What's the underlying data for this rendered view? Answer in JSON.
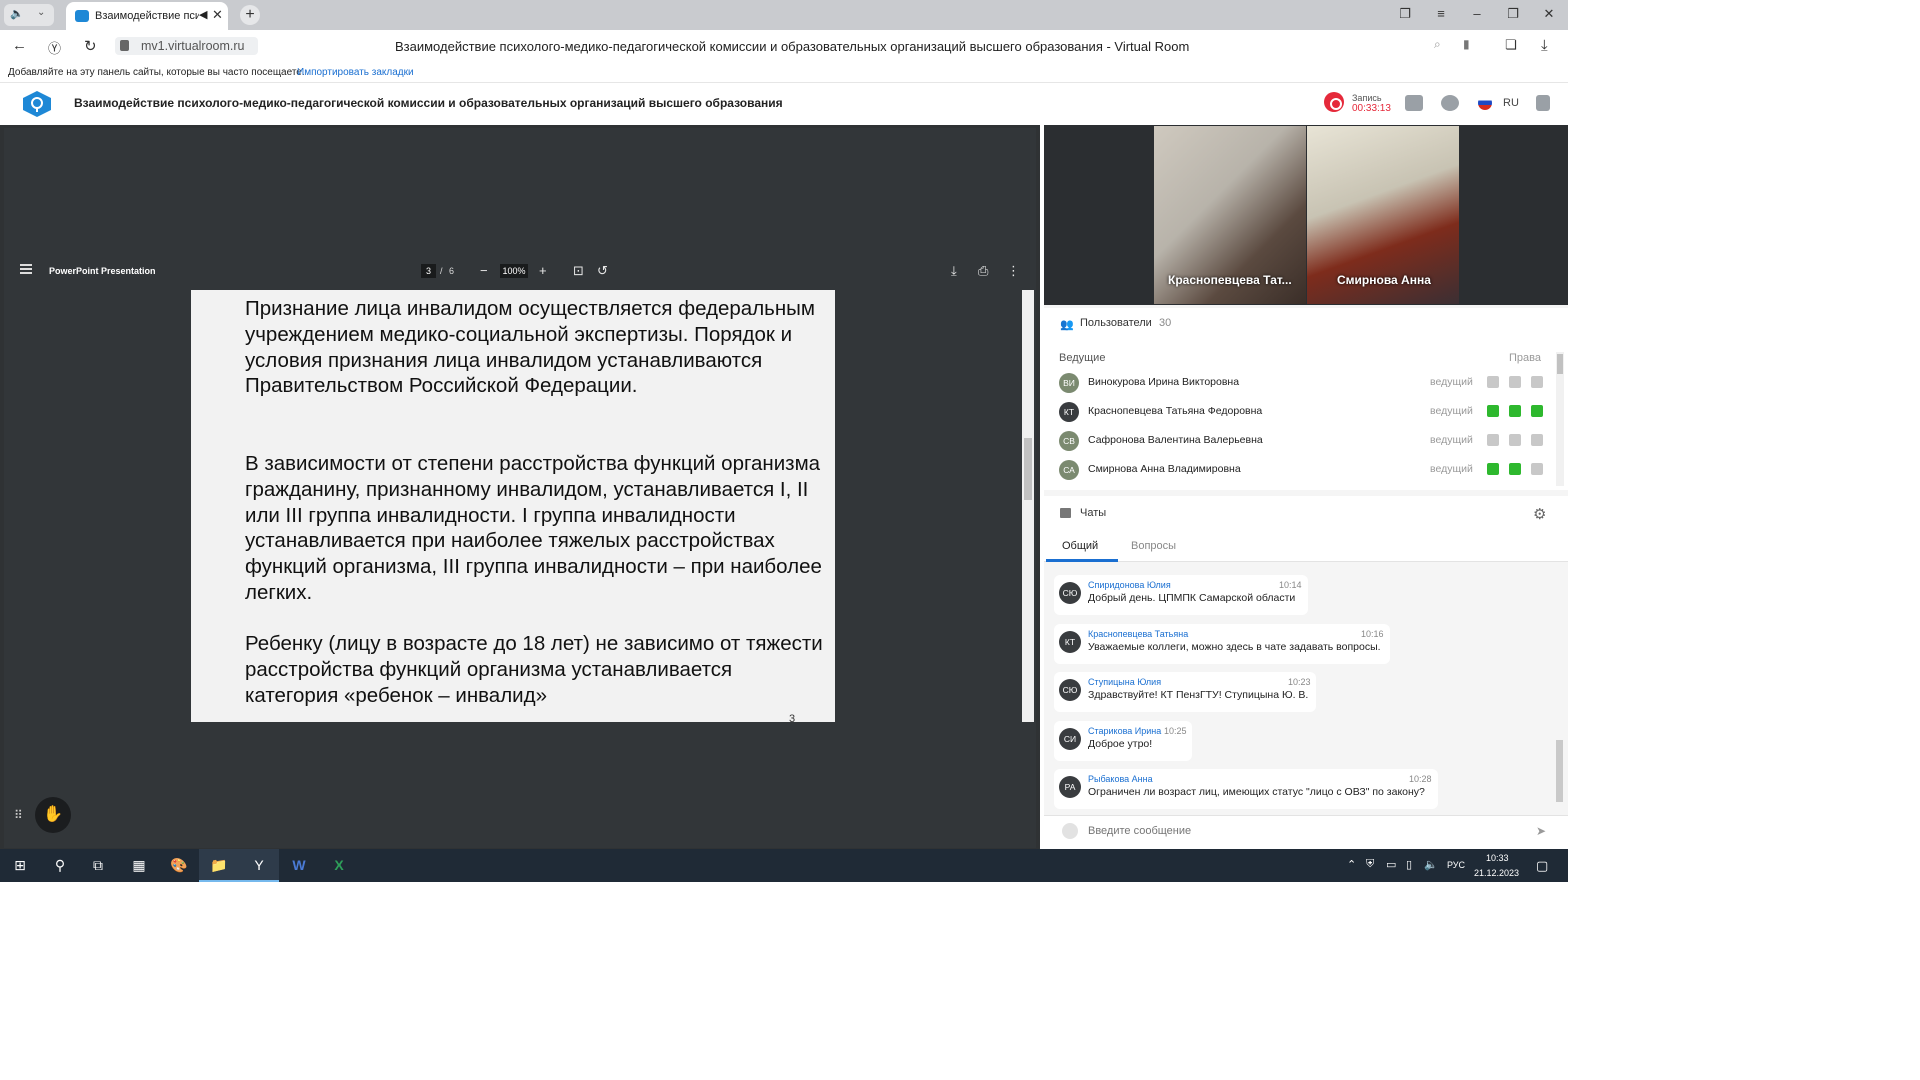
{
  "browser": {
    "tab_title": "Взаимодействие пси",
    "url": "mv1.virtualroom.ru",
    "page_title": "Взаимодействие психолого-медико-педагогической комиссии и образовательных организаций высшего образования - Virtual Room",
    "bookmarks_hint": "Добавляйте на эту панель сайты, которые вы часто посещаете.",
    "bookmarks_link": "Импортировать закладки"
  },
  "app": {
    "title": "Взаимодействие психолого-медико-педагогической комиссии и образовательных организаций высшего образования",
    "record_label": "Запись",
    "record_time": "00:33:13",
    "language": "RU"
  },
  "pdf": {
    "title": "PowerPoint Presentation",
    "current_page": "3",
    "separator": "/",
    "total_pages": "6",
    "zoom": "100%",
    "paragraphs": [
      "Признание лица инвалидом осуществляется федеральным учреждением медико-социальной экспертизы. Порядок и условия признания лица инвалидом устанавливаются Правительством Российской Федерации.",
      "В зависимости от степени расстройства функций организма гражданину, признанному инвалидом, устанавливается I, II или III группа инвалидности. I группа инвалидности устанавливается при наиболее тяжелых расстройствах функций организма, III группа инвалидности – при наиболее легких.",
      "Ребенку (лицу в возрасте до 18 лет) не зависимо от тяжести расстройства функций организма устанавливается категория «ребенок – инвалид»"
    ],
    "slide_number": "3"
  },
  "video": {
    "participants": [
      "Краснопевцева Тат...",
      "Смирнова Анна"
    ]
  },
  "users": {
    "label": "Пользователи",
    "count": "30",
    "section": "Ведущие",
    "rights_label": "Права",
    "items": [
      {
        "initials": "ВИ",
        "name": "Винокурова Ирина Викторовна",
        "role": "ведущий",
        "color": "#7b8a70"
      },
      {
        "initials": "КТ",
        "name": "Краснопевцева Татьяна Федоровна",
        "role": "ведущий",
        "color": "#393c3f"
      },
      {
        "initials": "СВ",
        "name": "Сафронова Валентина Валерьевна",
        "role": "ведущий",
        "color": "#7b8a70"
      },
      {
        "initials": "СА",
        "name": "Смирнова Анна Владимировна",
        "role": "ведущий",
        "color": "#7b8a70"
      }
    ]
  },
  "chats": {
    "label": "Чаты",
    "tabs": [
      "Общий",
      "Вопросы"
    ],
    "messages": [
      {
        "initials": "СЮ",
        "author": "Спиридонова Юлия",
        "time": "10:14",
        "text": "Добрый день. ЦПМПК Самарской области"
      },
      {
        "initials": "КТ",
        "author": "Краснопевцева Татьяна",
        "time": "10:16",
        "text": "Уважаемые коллеги, можно здесь в чате задавать вопросы."
      },
      {
        "initials": "СЮ",
        "author": "Ступицына Юлия",
        "time": "10:23",
        "text": "Здравствуйте! КТ ПензГТУ! Ступицына Ю. В."
      },
      {
        "initials": "СИ",
        "author": "Старикова Ирина",
        "time": "10:25",
        "text": "Доброе утро!"
      },
      {
        "initials": "РА",
        "author": "Рыбакова Анна",
        "time": "10:28",
        "text": "Ограничен ли возраст лиц, имеющих статус \"лицо с ОВЗ\" по закону?"
      }
    ],
    "input_placeholder": "Введите сообщение"
  },
  "taskbar": {
    "lang": "РУС",
    "time": "10:33",
    "date": "21.12.2023"
  },
  "colors": {
    "accent": "#1a6fd1",
    "record": "#e5293a",
    "mic_on": "#2eb82e",
    "pdf_bg": "#323639"
  }
}
